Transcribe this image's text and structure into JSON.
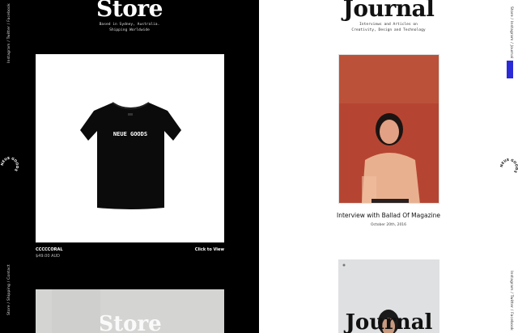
{
  "store": {
    "title": "Store",
    "tagline": "Based in Sydney, Australia.\nShipping Worldwide",
    "social_links": "Instagram / Twitter / Facebook",
    "footer_links": "Store / Shipping / Contact",
    "logo_text": "NEUE GOODS",
    "product": {
      "name": "CCCCCORAL",
      "price": "$49.00 AUD",
      "cta": "Click to View",
      "tee_print": "NEUE GOODS"
    },
    "next_product_overlay": "Store"
  },
  "journal": {
    "title": "Journal",
    "tagline": "Interviews and Articles on\nCreativity, Design and Technology",
    "right_links_top": "Store / Instagram / Journal",
    "right_links_bottom": "Instagram / Twitter / Facebook",
    "pill_label": "Join",
    "logo_text": "NEUE GOODS",
    "article": {
      "title": "Interview with Ballad Of Magazine",
      "date": "October 20th, 2016"
    },
    "next_article_overlay": "Journal"
  },
  "colors": {
    "store_bg": "#000000",
    "journal_bg": "#ffffff",
    "accent_pill": "#2a2ad6",
    "photo_bg": "#b94a33"
  }
}
